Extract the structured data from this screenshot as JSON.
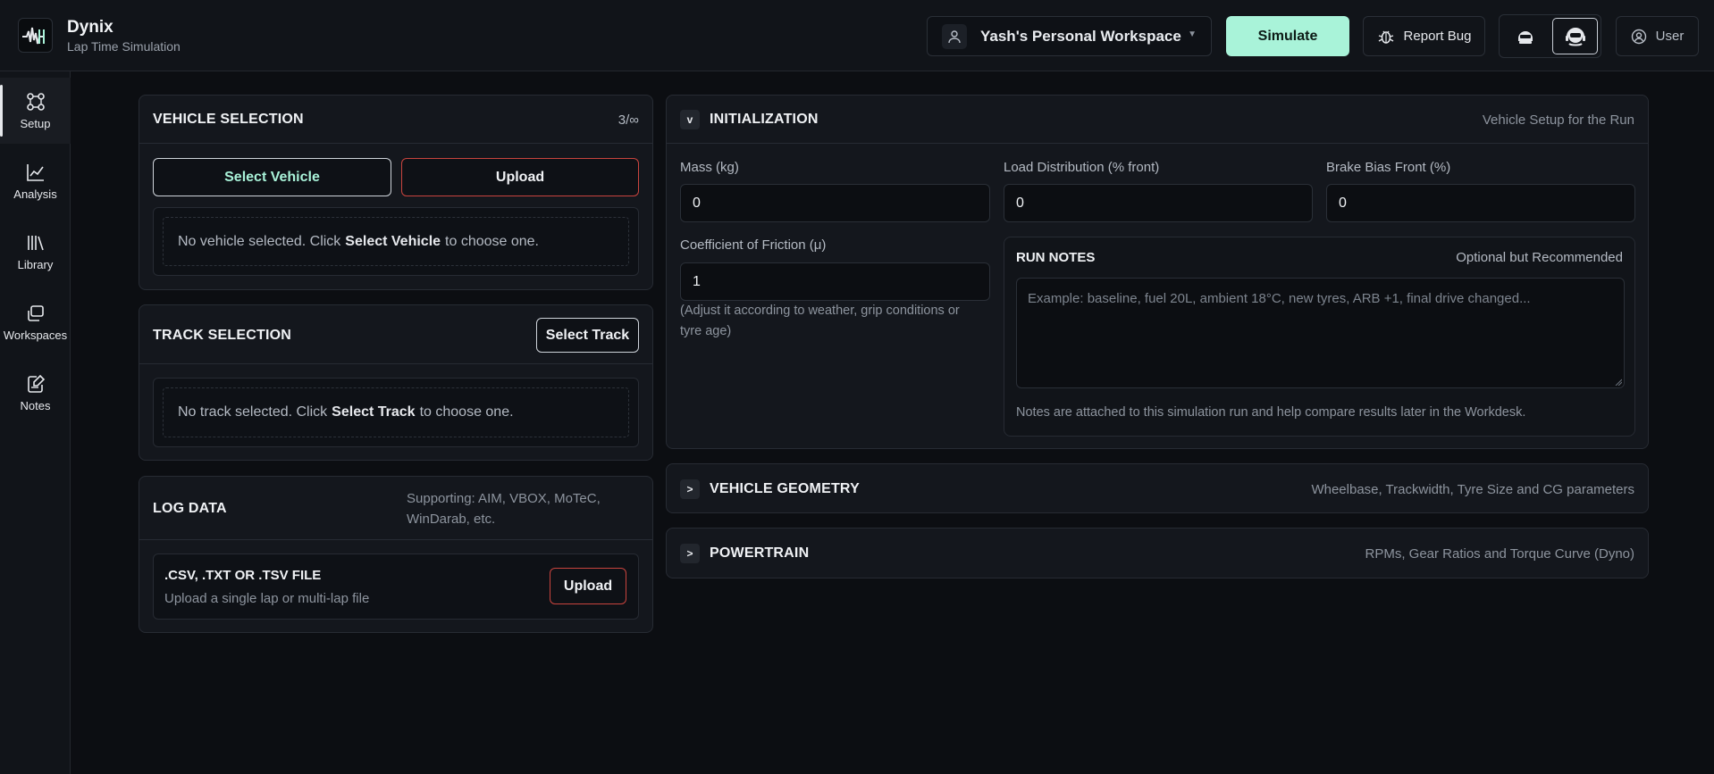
{
  "app": {
    "name": "Dynix",
    "subtitle": "Lap Time Simulation"
  },
  "header": {
    "workspace_label": "Yash's Personal Workspace",
    "simulate_label": "Simulate",
    "report_bug_label": "Report Bug",
    "user_label": "User",
    "accent_color": "#a9f3d9"
  },
  "sidebar": {
    "items": [
      {
        "label": "Setup",
        "icon": "setup-icon",
        "active": true
      },
      {
        "label": "Analysis",
        "icon": "analysis-chart-icon"
      },
      {
        "label": "Library",
        "icon": "library-icon"
      },
      {
        "label": "Workspaces",
        "icon": "workspaces-icon"
      },
      {
        "label": "Notes",
        "icon": "notes-icon"
      }
    ]
  },
  "vehicle_selection": {
    "title": "VEHICLE SELECTION",
    "count": "3/∞",
    "select_label": "Select Vehicle",
    "upload_label": "Upload",
    "empty_prefix": "No vehicle selected. Click",
    "empty_bold": "Select Vehicle",
    "empty_suffix": "to choose one."
  },
  "track_selection": {
    "title": "TRACK SELECTION",
    "select_label": "Select Track",
    "empty_prefix": "No track selected. Click",
    "empty_bold": "Select Track",
    "empty_suffix": "to choose one."
  },
  "log_data": {
    "title": "LOG DATA",
    "supporting_line1": "Supporting: AIM, VBOX, MoTeC,",
    "supporting_line2": "WinDarab, etc.",
    "file_title": ".CSV, .TXT OR .TSV FILE",
    "file_sub": "Upload a single lap or multi-lap file",
    "upload_label": "Upload"
  },
  "initialization": {
    "toggle": "v",
    "title": "INITIALIZATION",
    "subtitle": "Vehicle Setup for the Run",
    "fields": {
      "mass_label": "Mass (kg)",
      "mass_value": "0",
      "load_label": "Load Distribution (% front)",
      "load_value": "0",
      "brake_label": "Brake Bias Front (%)",
      "brake_value": "0",
      "friction_label": "Coefficient of Friction (μ)",
      "friction_value": "1",
      "friction_hint_line1": "(Adjust it according to weather, grip conditions or",
      "friction_hint_line2": "tyre age)"
    },
    "run_notes": {
      "title": "RUN NOTES",
      "badge": "Optional but Recommended",
      "placeholder": "Example: baseline, fuel 20L, ambient 18°C, new tyres, ARB +1, final drive changed...",
      "footer": "Notes are attached to this simulation run and help compare results later in the Workdesk."
    }
  },
  "vehicle_geometry": {
    "toggle": ">",
    "title": "VEHICLE GEOMETRY",
    "subtitle": "Wheelbase, Trackwidth, Tyre Size and CG parameters"
  },
  "powertrain": {
    "toggle": ">",
    "title": "POWERTRAIN",
    "subtitle": "RPMs, Gear Ratios and Torque Curve (Dyno)"
  }
}
